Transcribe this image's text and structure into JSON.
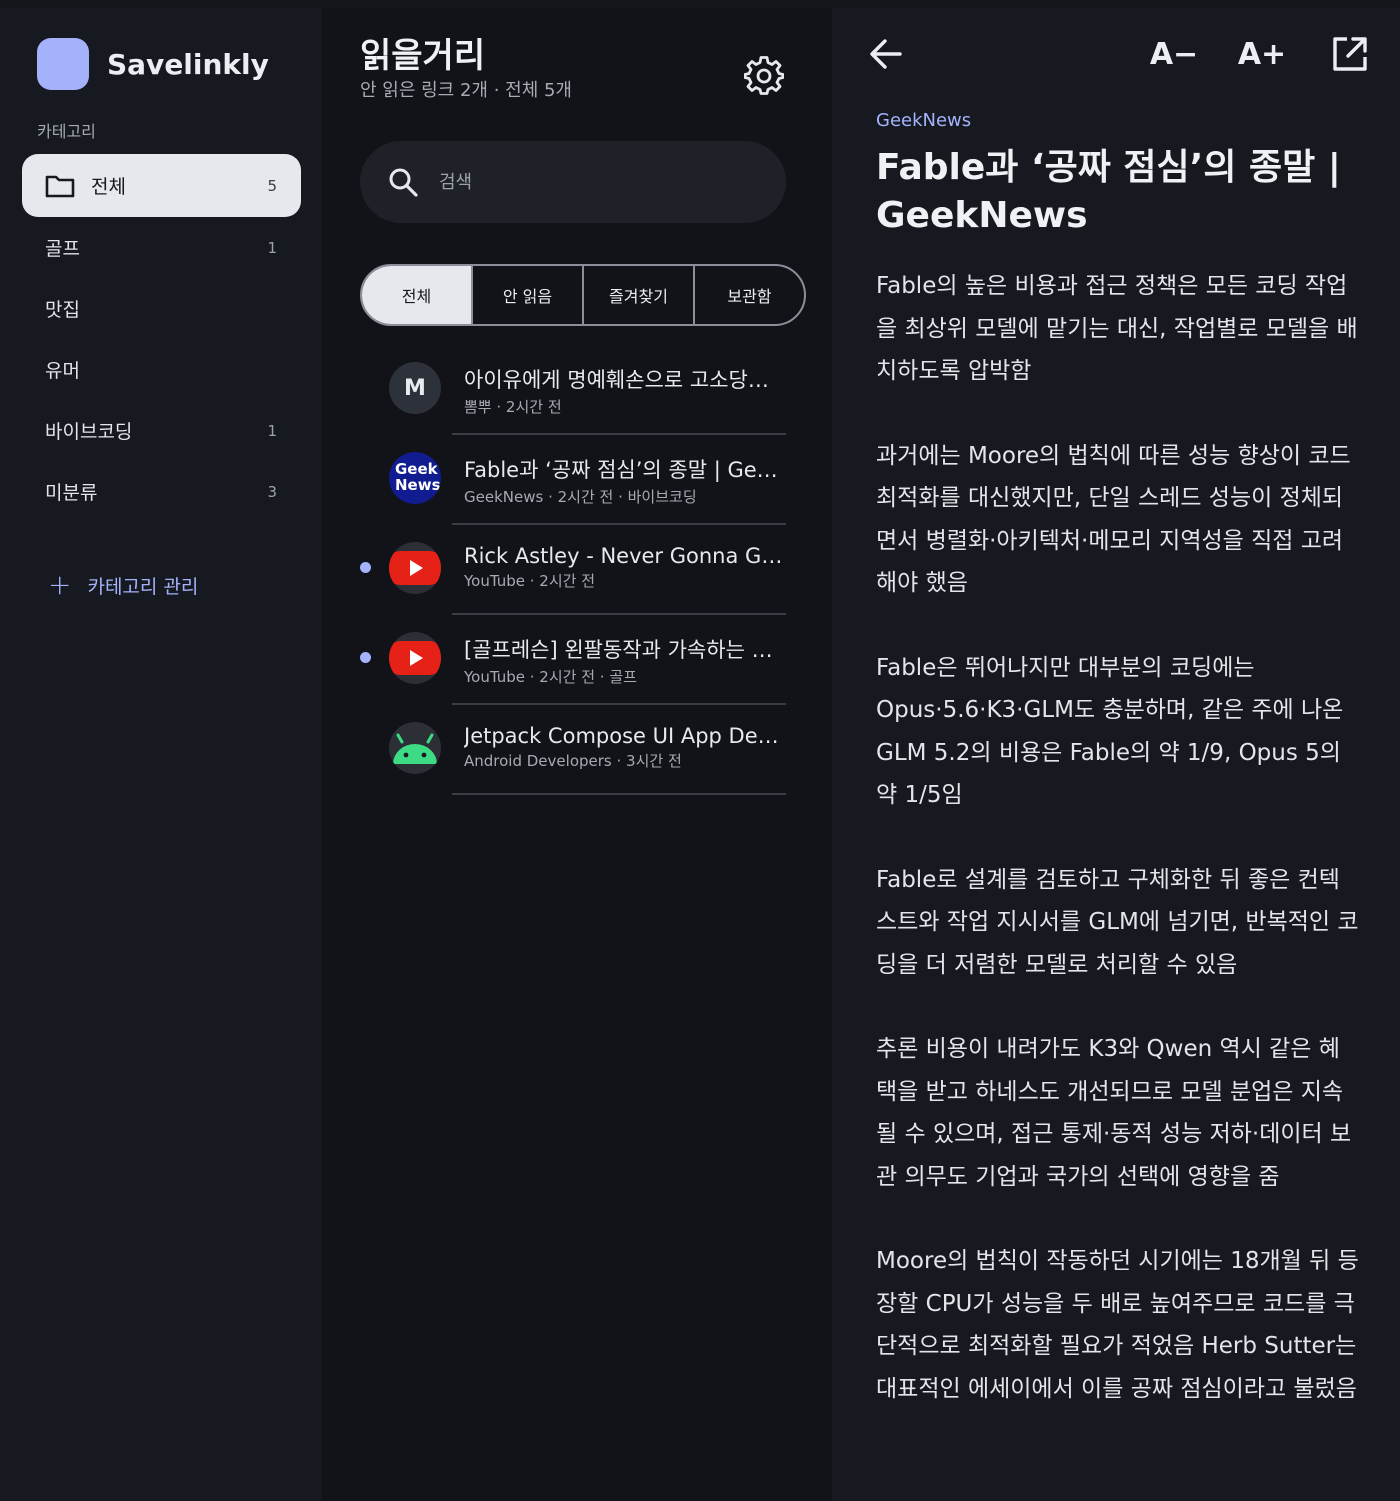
{
  "app": {
    "name": "Savelinkly"
  },
  "sidebar": {
    "heading": "카테고리",
    "categories": [
      {
        "label": "전체",
        "count": "5"
      },
      {
        "label": "골프",
        "count": "1"
      },
      {
        "label": "맛집",
        "count": ""
      },
      {
        "label": "유머",
        "count": ""
      },
      {
        "label": "바이브코딩",
        "count": "1"
      },
      {
        "label": "미분류",
        "count": "3"
      }
    ],
    "manage_label": "카테고리 관리"
  },
  "list": {
    "title": "읽을거리",
    "subtitle": "안 읽은 링크 2개 · 전체 5개",
    "search_placeholder": "검색",
    "tabs": [
      "전체",
      "안 읽음",
      "즐겨찾기",
      "보관함"
    ],
    "items": [
      {
        "avatar_text": "M",
        "avatar_type": "letter",
        "title": "아이유에게 명예훼손으로 고소당했...",
        "meta": "뽐뿌 · 2시간 전",
        "unread": false
      },
      {
        "avatar_text": "Geek News",
        "avatar_type": "geeknews",
        "title": "Fable과 ‘공짜 점심’의 종말 | Geek...",
        "meta": "GeekNews · 2시간 전 · 바이브코딩",
        "unread": false
      },
      {
        "avatar_text": "",
        "avatar_type": "youtube-icon",
        "title": "Rick Astley - Never Gonna Giv...",
        "meta": "YouTube · 2시간 전",
        "unread": true
      },
      {
        "avatar_text": "",
        "avatar_type": "youtube-icon",
        "title": "[골프레슨] 왼팔동작과 가속하는 방...",
        "meta": "YouTube · 2시간 전 · 골프",
        "unread": true
      },
      {
        "avatar_text": "",
        "avatar_type": "android-icon",
        "title": "Jetpack Compose UI App Dev...",
        "meta": "Android Developers · 3시간 전",
        "unread": false
      }
    ]
  },
  "reader": {
    "font_decrease": "A−",
    "font_increase": "A+",
    "source": "GeekNews",
    "title": "Fable과 ‘공짜 점심’의 종말 | GeekNews",
    "paragraphs": [
      "Fable의 높은 비용과 접근 정책은 모든 코딩 작업을 최상위 모델에 맡기는 대신, 작업별로 모델을 배치하도록 압박함",
      "과거에는 Moore의 법칙에 따른 성능 향상이 코드 최적화를 대신했지만, 단일 스레드 성능이 정체되면서 병렬화·아키텍처·메모리 지역성을 직접 고려해야 했음",
      "Fable은 뛰어나지만 대부분의 코딩에는 Opus·5.6·K3·GLM도 충분하며, 같은 주에 나온 GLM 5.2의 비용은 Fable의 약 1/9, Opus 5의 약 1/5임",
      "Fable로 설계를 검토하고 구체화한 뒤 좋은 컨텍스트와 작업 지시서를 GLM에 넘기면, 반복적인 코딩을 더 저렴한 모델로 처리할 수 있음",
      "추론 비용이 내려가도 K3와 Qwen 역시 같은 혜택을 받고 하네스도 개선되므로 모델 분업은 지속될 수 있으며, 접근 통제·동적 성능 저하·데이터 보관 의무도 기업과 국가의 선택에 영향을 줌",
      "Moore의 법칙이 작동하던 시기에는 18개월 뒤 등장할 CPU가 성능을 두 배로 높여주므로 코드를 극단적으로 최적화할 필요가 적었음 Herb Sutter는 대표적인 에세이에서 이를 공짜 점심이라고 불렀음"
    ]
  },
  "colors": {
    "accent": "#a4b3fb",
    "youtube": "#e62117",
    "geeknews": "#101c8f",
    "android": "#3ddc84"
  }
}
